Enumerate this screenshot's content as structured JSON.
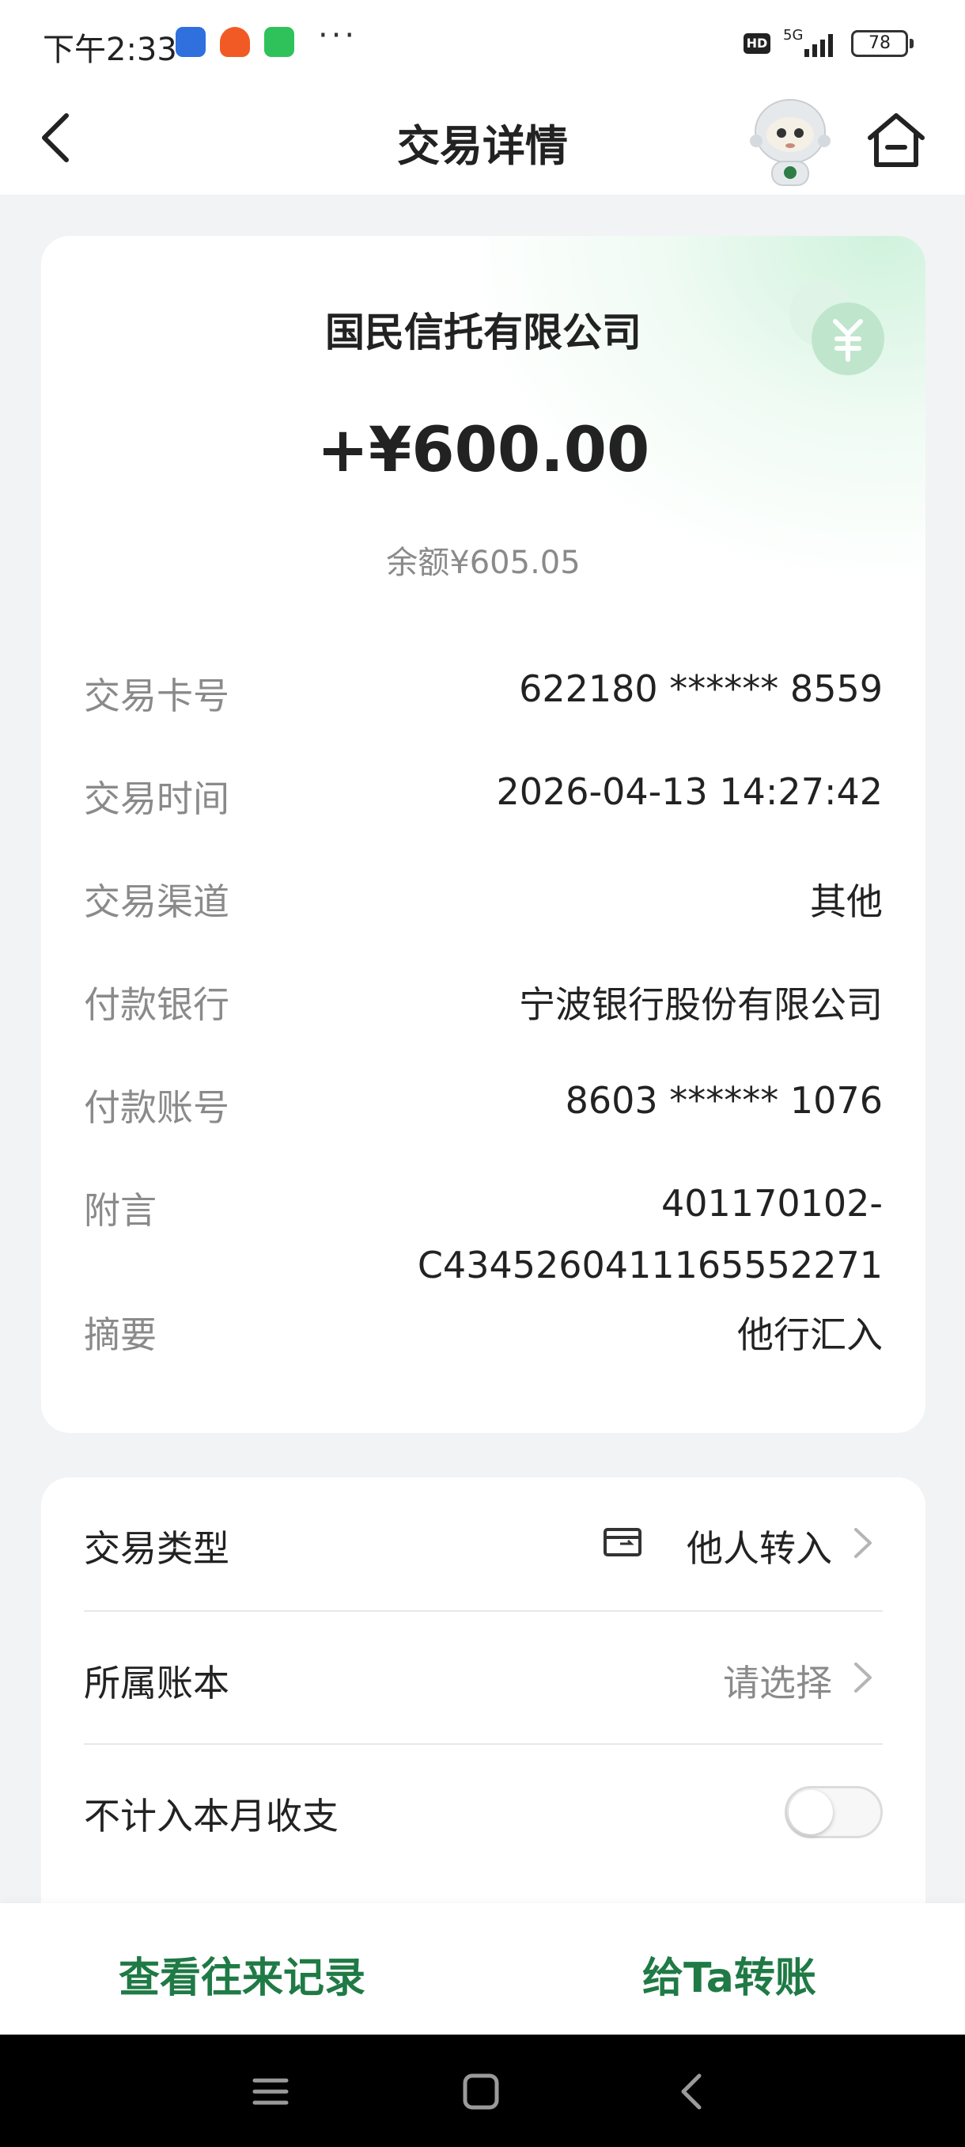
{
  "status_bar": {
    "time": "下午2:33",
    "more": "···",
    "hd": "HD",
    "network": "5G",
    "battery": "78"
  },
  "nav": {
    "title": "交易详情"
  },
  "transaction": {
    "payer": "国民信托有限公司",
    "amount": "+¥600.00",
    "balance": "余额¥605.05",
    "details": [
      {
        "label": "交易卡号",
        "value": "622180 ****** 8559"
      },
      {
        "label": "交易时间",
        "value": "2026-04-13 14:27:42"
      },
      {
        "label": "交易渠道",
        "value": "其他"
      },
      {
        "label": "付款银行",
        "value": "宁波银行股份有限公司"
      },
      {
        "label": "付款账号",
        "value": "8603 ****** 1076"
      },
      {
        "label": "附言",
        "value_line1": "401170102-",
        "value_line2": "C4345260411165552271"
      },
      {
        "label": "摘要",
        "value": "他行汇入"
      }
    ]
  },
  "options": {
    "type_label": "交易类型",
    "type_value": "他人转入",
    "ledger_label": "所属账本",
    "ledger_value": "请选择",
    "exclude_label": "不计入本月收支",
    "exclude_enabled": false
  },
  "actions": {
    "history": "查看往来记录",
    "transfer": "给Ta转账"
  },
  "colors": {
    "brand_green": "#1f7a45",
    "muted_text": "#8a8a8a"
  }
}
